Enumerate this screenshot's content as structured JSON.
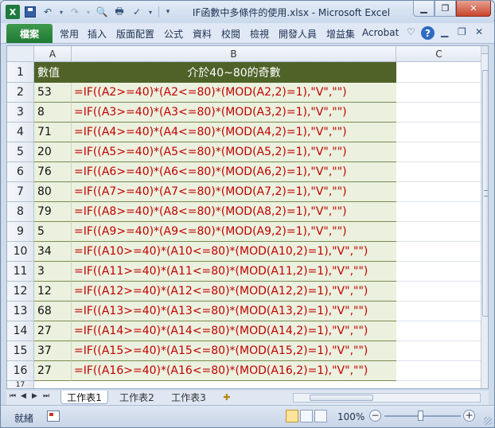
{
  "window": {
    "title": "IF函數中多條件的使用.xlsx - Microsoft Excel",
    "logo": "X"
  },
  "ribbon": {
    "file_tab": "檔案",
    "tabs": [
      "常用",
      "插入",
      "版面配置",
      "公式",
      "資料",
      "校閱",
      "檢視",
      "開發人員",
      "增益集",
      "Acrobat"
    ],
    "help": "?"
  },
  "sheet": {
    "columns": [
      "A",
      "B",
      "C"
    ],
    "header_row": {
      "row": "1",
      "a": "數值",
      "b": "介於40~80的奇數"
    },
    "rows": [
      {
        "row": "2",
        "a": "53",
        "b": "=IF((A2>=40)*(A2<=80)*(MOD(A2,2)=1),\"V\",\"\")"
      },
      {
        "row": "3",
        "a": "8",
        "b": "=IF((A3>=40)*(A3<=80)*(MOD(A3,2)=1),\"V\",\"\")"
      },
      {
        "row": "4",
        "a": "71",
        "b": "=IF((A4>=40)*(A4<=80)*(MOD(A4,2)=1),\"V\",\"\")"
      },
      {
        "row": "5",
        "a": "20",
        "b": "=IF((A5>=40)*(A5<=80)*(MOD(A5,2)=1),\"V\",\"\")"
      },
      {
        "row": "6",
        "a": "76",
        "b": "=IF((A6>=40)*(A6<=80)*(MOD(A6,2)=1),\"V\",\"\")"
      },
      {
        "row": "7",
        "a": "80",
        "b": "=IF((A7>=40)*(A7<=80)*(MOD(A7,2)=1),\"V\",\"\")"
      },
      {
        "row": "8",
        "a": "79",
        "b": "=IF((A8>=40)*(A8<=80)*(MOD(A8,2)=1),\"V\",\"\")"
      },
      {
        "row": "9",
        "a": "5",
        "b": "=IF((A9>=40)*(A9<=80)*(MOD(A9,2)=1),\"V\",\"\")"
      },
      {
        "row": "10",
        "a": "34",
        "b": "=IF((A10>=40)*(A10<=80)*(MOD(A10,2)=1),\"V\",\"\")"
      },
      {
        "row": "11",
        "a": "3",
        "b": "=IF((A11>=40)*(A11<=80)*(MOD(A11,2)=1),\"V\",\"\")"
      },
      {
        "row": "12",
        "a": "12",
        "b": "=IF((A12>=40)*(A12<=80)*(MOD(A12,2)=1),\"V\",\"\")"
      },
      {
        "row": "13",
        "a": "68",
        "b": "=IF((A13>=40)*(A13<=80)*(MOD(A13,2)=1),\"V\",\"\")"
      },
      {
        "row": "14",
        "a": "27",
        "b": "=IF((A14>=40)*(A14<=80)*(MOD(A14,2)=1),\"V\",\"\")"
      },
      {
        "row": "15",
        "a": "37",
        "b": "=IF((A15>=40)*(A15<=80)*(MOD(A15,2)=1),\"V\",\"\")"
      },
      {
        "row": "16",
        "a": "27",
        "b": "=IF((A16>=40)*(A16<=80)*(MOD(A16,2)=1),\"V\",\"\")"
      }
    ],
    "tail_row": "17"
  },
  "sheet_tabs": [
    "工作表1",
    "工作表2",
    "工作表3"
  ],
  "status": {
    "ready": "就緒",
    "zoom": "100%",
    "zoom_out": "−",
    "zoom_in": "+"
  },
  "colors": {
    "header_fill": "#4f6228",
    "row_fill": "#ebf1de",
    "formula_text": "#c00000",
    "file_tab": "#1f7a32"
  },
  "icons": [
    "excel-logo-icon",
    "save-icon",
    "undo-icon",
    "redo-icon",
    "print-preview-icon",
    "print-icon",
    "spellcheck-icon",
    "customize-qat-icon",
    "minimize-icon",
    "restore-icon",
    "close-icon",
    "ribbon-collapse-icon",
    "help-icon",
    "new-sheet-icon",
    "macro-record-icon"
  ]
}
